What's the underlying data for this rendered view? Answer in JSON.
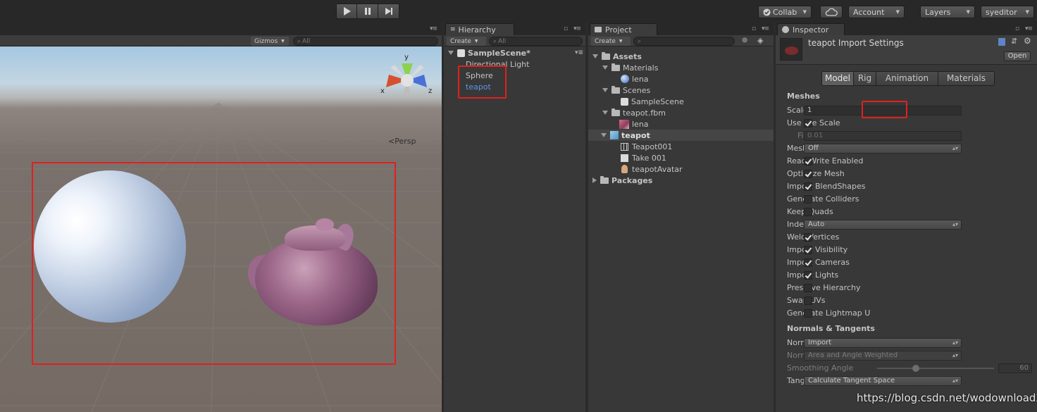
{
  "toolbar": {
    "collab": "Collab",
    "account": "Account",
    "layers": "Layers",
    "layout": "syeditor"
  },
  "scene": {
    "gizmos": "Gizmos",
    "search_placeholder": "All",
    "persp": "Persp",
    "axis_y": "y",
    "axis_x": "x",
    "axis_z": "z"
  },
  "hierarchy": {
    "tab": "Hierarchy",
    "create": "Create",
    "search_placeholder": "All",
    "scene": "SampleScene*",
    "items": [
      "Directional Light",
      "Sphere",
      "teapot"
    ]
  },
  "project": {
    "tab": "Project",
    "create": "Create",
    "items": [
      "Assets",
      "Materials",
      "lena",
      "Scenes",
      "SampleScene",
      "teapot.fbm",
      "lena",
      "teapot",
      "Teapot001",
      "Take 001",
      "teapotAvatar",
      "Packages"
    ]
  },
  "inspector": {
    "tab": "Inspector",
    "title": "teapot Import Settings",
    "open": "Open",
    "tabs": [
      "Model",
      "Rig",
      "Animation",
      "Materials"
    ],
    "section_meshes": "Meshes",
    "section_normals": "Normals & Tangents",
    "labels": {
      "scale_factor": "Scale Factor",
      "use_file_scale": "Use File Scale",
      "file_scale": "File Scale",
      "mesh_compression": "Mesh Compression",
      "read_write": "Read/Write Enabled",
      "optimize_mesh": "Optimize Mesh",
      "blendshapes": "Import BlendShapes",
      "colliders": "Generate Colliders",
      "keep_quads": "Keep Quads",
      "index_format": "Index Format",
      "weld_vertices": "Weld Vertices",
      "import_visibility": "Import Visibility",
      "import_cameras": "Import Cameras",
      "import_lights": "Import Lights",
      "preserve_hierarchy": "Preserve Hierarchy",
      "swap_uvs": "Swap UVs",
      "lightmap_uvs": "Generate Lightmap U",
      "normals": "Normals",
      "normals_mode": "Normals Mode",
      "smoothing_angle": "Smoothing Angle",
      "tangents": "Tangents"
    },
    "values": {
      "scale_factor": "1",
      "file_scale": "0.01",
      "mesh_compression": "Off",
      "index_format": "Auto",
      "normals": "Import",
      "normals_mode": "Area and Angle Weighted",
      "smoothing_angle": "60",
      "tangents": "Calculate Tangent Space"
    }
  },
  "watermark": "https://blog.csdn.net/wodownload2",
  "colors": {
    "highlight": "#e02020",
    "selected_text": "#5a96e6"
  }
}
